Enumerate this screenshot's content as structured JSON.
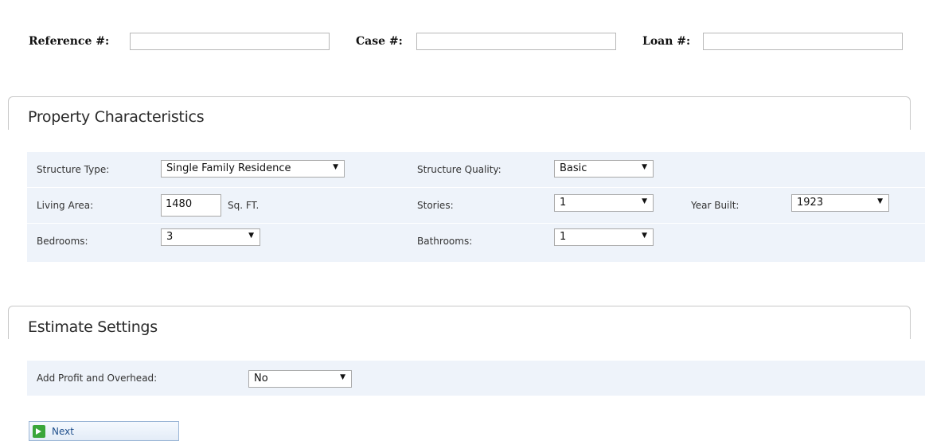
{
  "header": {
    "reference_label": "Reference #:",
    "reference_value": "",
    "case_label": "Case #:",
    "case_value": "",
    "loan_label": "Loan #:",
    "loan_value": ""
  },
  "property": {
    "title": "Property Characteristics",
    "structure_type_label": "Structure Type:",
    "structure_type_value": "Single Family Residence",
    "structure_quality_label": "Structure Quality:",
    "structure_quality_value": "Basic",
    "living_area_label": "Living Area:",
    "living_area_value": "1480",
    "living_area_unit": "Sq. FT.",
    "stories_label": "Stories:",
    "stories_value": "1",
    "year_built_label": "Year Built:",
    "year_built_value": "1923",
    "bedrooms_label": "Bedrooms:",
    "bedrooms_value": "3",
    "bathrooms_label": "Bathrooms:",
    "bathrooms_value": "1"
  },
  "estimate": {
    "title": "Estimate Settings",
    "profit_label": "Add Profit and Overhead:",
    "profit_value": "No"
  },
  "actions": {
    "next_label": "Next",
    "next_icon": "arrow-right-icon",
    "dropdown_arrow": "▼"
  },
  "colors": {
    "form_background": "#eef3fa",
    "next_icon": "#3aa63a",
    "next_text": "#1f4f8c"
  }
}
